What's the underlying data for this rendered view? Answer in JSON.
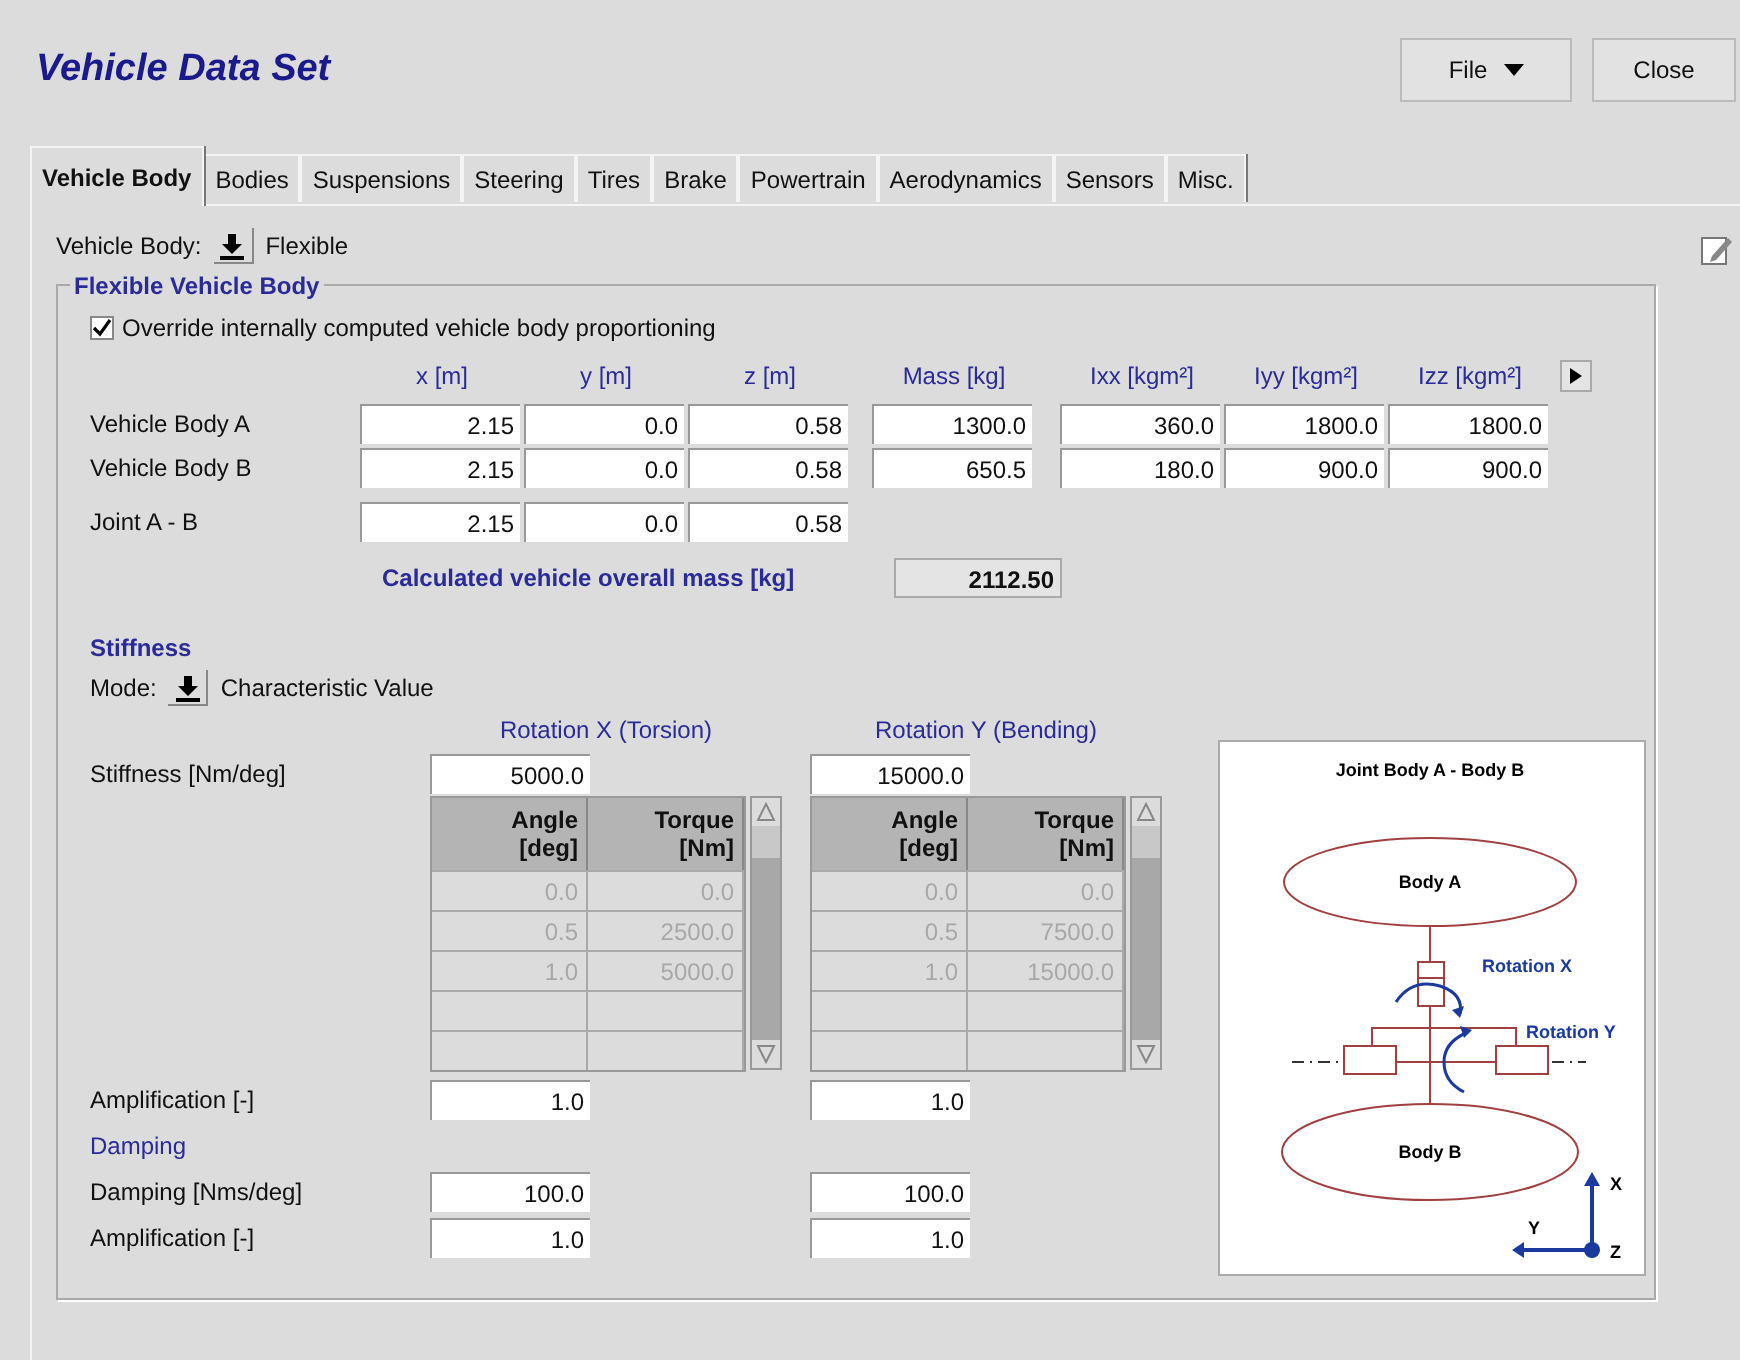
{
  "window": {
    "title": "Vehicle Data Set"
  },
  "toolbar": {
    "file_menu": "File",
    "close": "Close"
  },
  "tabs": [
    {
      "label": "Vehicle Body",
      "selected": true
    },
    {
      "label": "Bodies",
      "selected": false
    },
    {
      "label": "Suspensions",
      "selected": false
    },
    {
      "label": "Steering",
      "selected": false
    },
    {
      "label": "Tires",
      "selected": false
    },
    {
      "label": "Brake",
      "selected": false
    },
    {
      "label": "Powertrain",
      "selected": false
    },
    {
      "label": "Aerodynamics",
      "selected": false
    },
    {
      "label": "Sensors",
      "selected": false
    },
    {
      "label": "Misc.",
      "selected": false
    }
  ],
  "vehicle_body": {
    "label": "Vehicle Body:",
    "value": "Flexible"
  },
  "group": {
    "title": "Flexible Vehicle Body",
    "override": {
      "label": "Override internally computed vehicle body proportioning",
      "checked": true
    },
    "columns": [
      "x [m]",
      "y [m]",
      "z [m]",
      "Mass [kg]",
      "Ixx [kgm²]",
      "Iyy [kgm²]",
      "Izz [kgm²]"
    ],
    "rows": [
      {
        "label": "Vehicle Body A",
        "values": [
          "2.15",
          "0.0",
          "0.58",
          "1300.0",
          "360.0",
          "1800.0",
          "1800.0"
        ]
      },
      {
        "label": "Vehicle Body B",
        "values": [
          "2.15",
          "0.0",
          "0.58",
          "650.5",
          "180.0",
          "900.0",
          "900.0"
        ]
      },
      {
        "label": "Joint A - B",
        "values": [
          "2.15",
          "0.0",
          "0.58"
        ]
      }
    ],
    "total": {
      "label": "Calculated vehicle overall mass [kg]",
      "value": "2112.50"
    }
  },
  "stiffness": {
    "title": "Stiffness",
    "mode_label": "Mode:",
    "mode_value": "Characteristic Value",
    "stiffness_label": "Stiffness [Nm/deg]",
    "amplification_label": "Amplification [-]",
    "damping_title": "Damping",
    "damping_label": "Damping [Nms/deg]",
    "damping_amplification_label": "Amplification [-]",
    "rotations": [
      {
        "title": "Rotation X (Torsion)",
        "stiffness": "5000.0",
        "table": {
          "disabled": true,
          "columns": [
            "Angle [deg]",
            "Torque [Nm]"
          ],
          "rows": [
            [
              "0.0",
              "0.0"
            ],
            [
              "0.5",
              "2500.0"
            ],
            [
              "1.0",
              "5000.0"
            ]
          ]
        },
        "amplification": "1.0",
        "damping": "100.0",
        "damping_amplification": "1.0"
      },
      {
        "title": "Rotation Y (Bending)",
        "stiffness": "15000.0",
        "table": {
          "disabled": true,
          "columns": [
            "Angle [deg]",
            "Torque [Nm]"
          ],
          "rows": [
            [
              "0.0",
              "0.0"
            ],
            [
              "0.5",
              "7500.0"
            ],
            [
              "1.0",
              "15000.0"
            ]
          ]
        },
        "amplification": "1.0",
        "damping": "100.0",
        "damping_amplification": "1.0"
      }
    ]
  },
  "diagram": {
    "title": "Joint Body A - Body B",
    "body_a": "Body A",
    "rotation_x": "Rotation X",
    "rotation_y": "Rotation Y",
    "body_b": "Body B",
    "axis_x": "X",
    "axis_y": "Y",
    "axis_z": "Z"
  }
}
